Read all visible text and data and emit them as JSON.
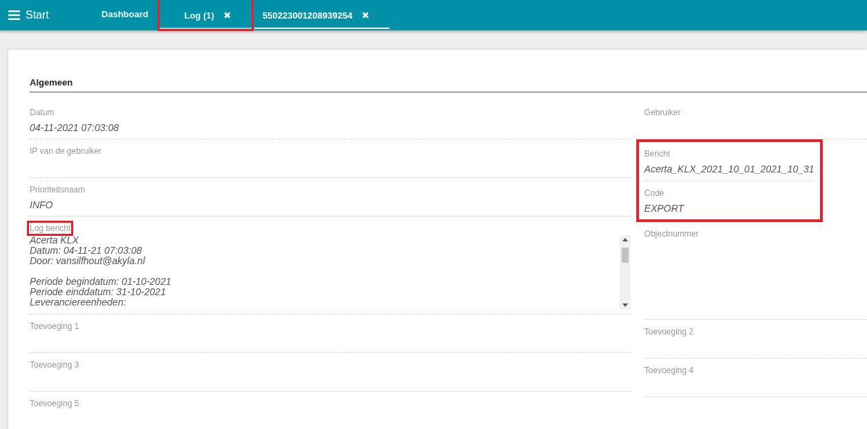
{
  "header": {
    "menu_label": "Start",
    "tabs": [
      {
        "label": "Dashboard",
        "closable": false,
        "selected": false,
        "highlighted": false
      },
      {
        "label": "Log (1)",
        "closable": true,
        "selected": false,
        "highlighted": true
      },
      {
        "label": "550223001208939254",
        "closable": true,
        "selected": true,
        "highlighted": false
      }
    ]
  },
  "section": {
    "title": "Algemeen",
    "left_fields": [
      {
        "kind": "text",
        "label": "Datum",
        "value": "04-11-2021 07:03:08",
        "highlighted": false
      },
      {
        "kind": "text",
        "label": "IP van de gebruiker",
        "highlighted": false
      },
      {
        "kind": "text",
        "label": "Prioriteitsnaam",
        "value": "INFO",
        "highlighted": false
      },
      {
        "kind": "textarea",
        "label": "Log bericht",
        "highlighted": true,
        "paragraphs": [
          [
            "Acerta KLX",
            "Datum: 04-11-21 07:03:08",
            "Door: vansilfhout@akyla.nl"
          ],
          [
            "Periode begindatum: 01-10-2021",
            "Periode einddatum: 31-10-2021",
            "Leveranciereenheden:"
          ]
        ]
      },
      {
        "kind": "text",
        "label": "Toevoeging 1",
        "highlighted": false
      },
      {
        "kind": "text",
        "label": "Toevoeging 3",
        "highlighted": false
      },
      {
        "kind": "text",
        "label": "Toevoeging 5",
        "highlighted": false
      }
    ],
    "right_fields": [
      {
        "kind": "text",
        "label": "Gebruiker",
        "highlighted": false
      },
      {
        "kind": "text",
        "label": "Bericht",
        "value": "Acerta_KLX_2021_10_01_2021_10_31",
        "highlighted": true
      },
      {
        "kind": "text",
        "label": "Code",
        "value": "EXPORT",
        "highlighted": true
      },
      {
        "kind": "tall",
        "label": "Objectnummer",
        "highlighted": false
      },
      {
        "kind": "text",
        "label": "Toevoeging 2",
        "highlighted": false
      },
      {
        "kind": "text",
        "label": "Toevoeging 4",
        "highlighted": false
      }
    ]
  }
}
